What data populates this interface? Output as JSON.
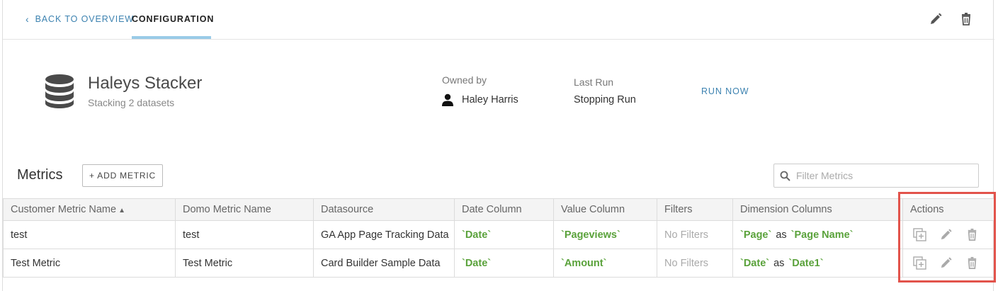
{
  "nav": {
    "back_label": "BACK TO OVERVIEW",
    "config_tab": "CONFIGURATION"
  },
  "header": {
    "title": "Haleys Stacker",
    "subtitle": "Stacking 2 datasets",
    "owned_by_label": "Owned by",
    "owner_name": "Haley Harris",
    "last_run_label": "Last Run",
    "last_run_value": "Stopping Run",
    "run_now_label": "RUN NOW"
  },
  "metrics": {
    "title": "Metrics",
    "add_label": "+ ADD METRIC",
    "filter_placeholder": "Filter Metrics",
    "columns": {
      "customer": "Customer Metric Name",
      "domo": "Domo Metric Name",
      "datasource": "Datasource",
      "date": "Date Column",
      "value": "Value Column",
      "filters": "Filters",
      "dimension": "Dimension Columns",
      "actions": "Actions"
    },
    "rows": [
      {
        "customer": "test",
        "domo": "test",
        "datasource": "GA App Page Tracking Data",
        "date": "`Date`",
        "value": "`Pageviews`",
        "filters": "No Filters",
        "dim_from": "`Page`",
        "dim_as": "as",
        "dim_to": "`Page Name`"
      },
      {
        "customer": "Test Metric",
        "domo": "Test Metric",
        "datasource": "Card Builder Sample Data",
        "date": "`Date`",
        "value": "`Amount`",
        "filters": "No Filters",
        "dim_from": "`Date`",
        "dim_as": "as",
        "dim_to": "`Date1`"
      }
    ]
  },
  "colors": {
    "link_blue": "#3c82b0",
    "code_green": "#5aa23b",
    "highlight_red": "#e2534b",
    "tab_underline": "#99cbe7"
  },
  "icons": {
    "back": "chevron-left-icon",
    "edit": "pencil-icon",
    "delete": "trash-icon",
    "database": "database-icon",
    "owner": "person-icon",
    "search": "search-icon",
    "duplicate": "duplicate-icon"
  }
}
